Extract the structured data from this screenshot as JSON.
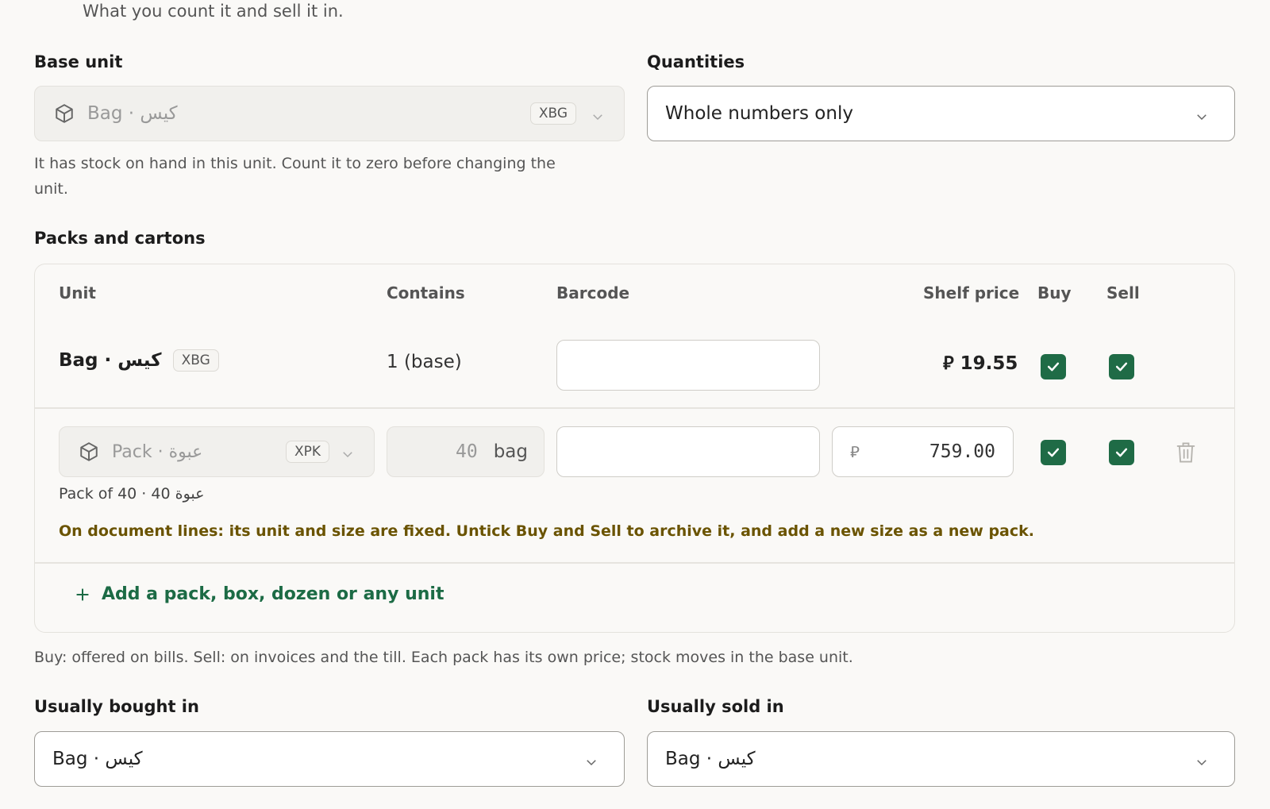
{
  "intro": {
    "subtitle": "What you count it and sell it in."
  },
  "base_unit": {
    "label": "Base unit",
    "value": "Bag · كيس",
    "code": "XBG",
    "help": "It has stock on hand in this unit. Count it to zero before changing the unit."
  },
  "quantities": {
    "label": "Quantities",
    "value": "Whole numbers only"
  },
  "packs": {
    "heading": "Packs and cartons",
    "columns": {
      "unit": "Unit",
      "contains": "Contains",
      "barcode": "Barcode",
      "shelf_price": "Shelf price",
      "buy": "Buy",
      "sell": "Sell"
    },
    "base_row": {
      "unit": "Bag · كيس",
      "code": "XBG",
      "contains": "1 (base)",
      "barcode": "",
      "price": "⃁ 19.55",
      "buy": true,
      "sell": true
    },
    "pack_row": {
      "unit": "Pack · عبوة",
      "code": "XPK",
      "contains_qty": "40",
      "contains_unit": "bag",
      "barcode": "",
      "currency": "⃁",
      "price": "759.00",
      "buy": true,
      "sell": true,
      "caption": "Pack of 40 · 40 عبوة",
      "warning": "On document lines: its unit and size are fixed. Untick Buy and Sell to archive it, and add a new size as a new pack."
    },
    "add_label": "Add a pack, box, dozen or any unit",
    "footnote": "Buy: offered on bills. Sell: on invoices and the till. Each pack has its own price; stock moves in the base unit."
  },
  "usually_bought": {
    "label": "Usually bought in",
    "value": "Bag · كيس"
  },
  "usually_sold": {
    "label": "Usually sold in",
    "value": "Bag · كيس"
  }
}
